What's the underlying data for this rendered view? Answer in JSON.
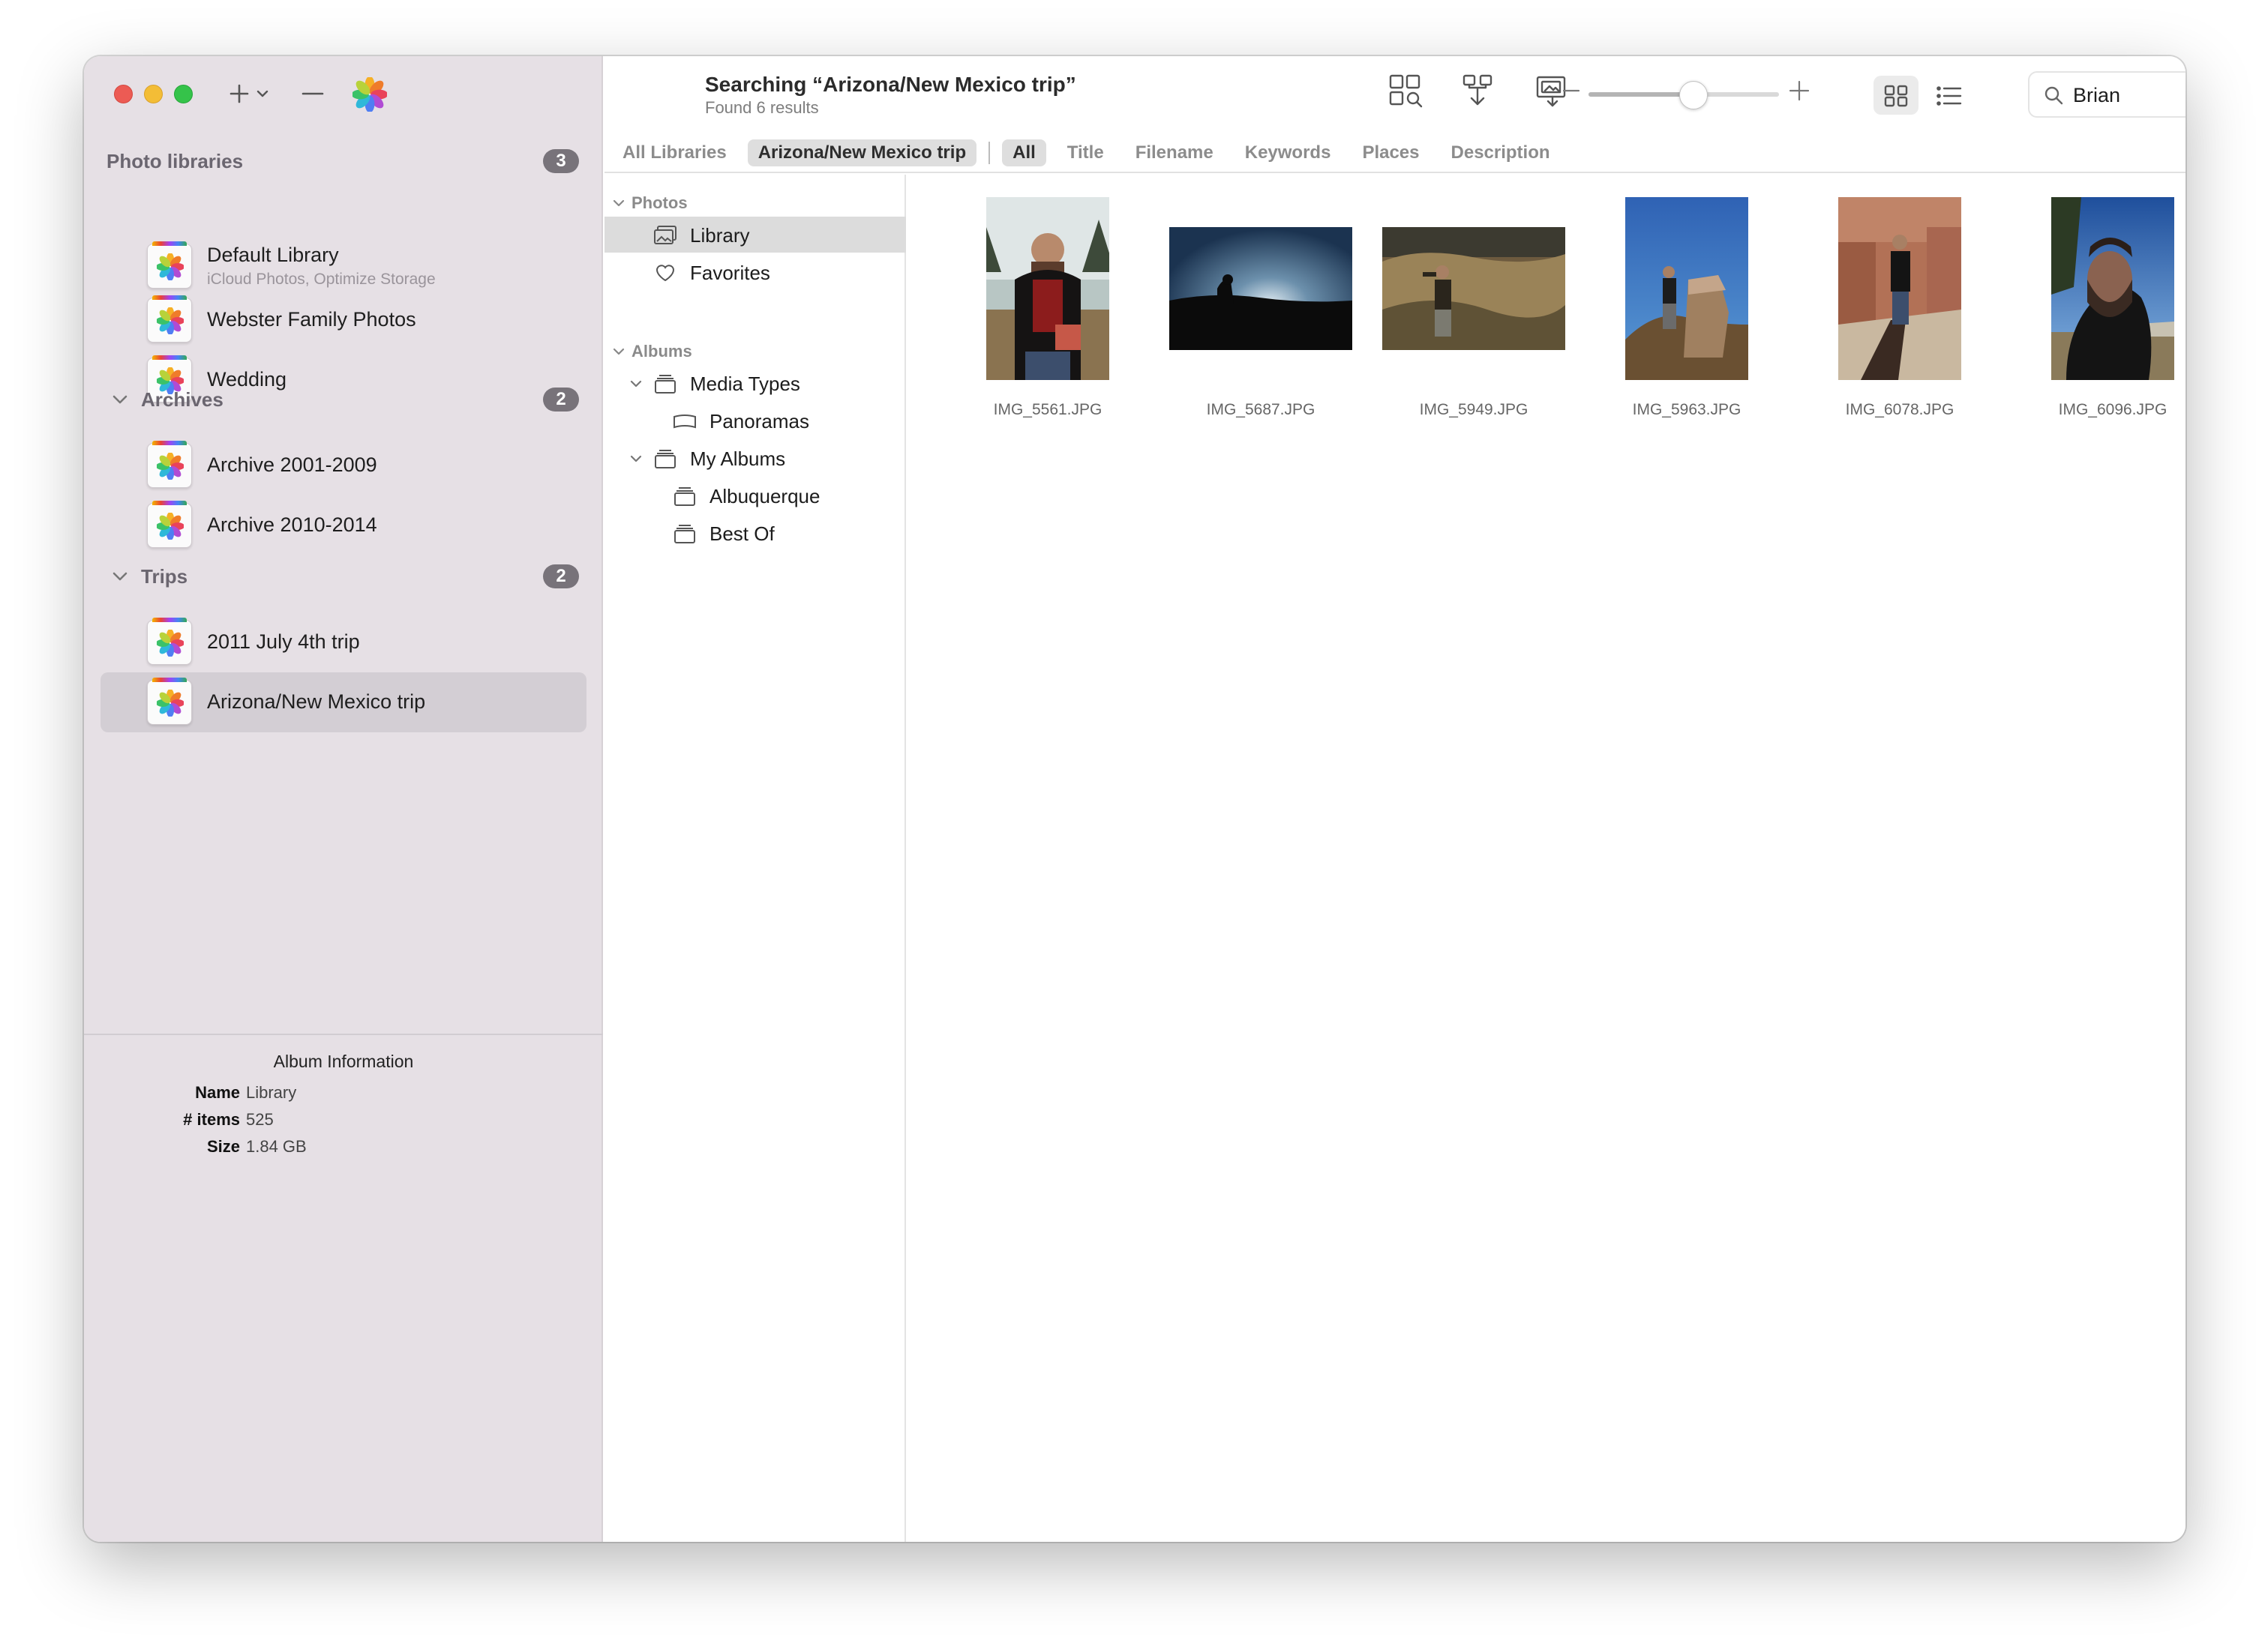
{
  "toolbar": {
    "title": "Searching “Arizona/New Mexico trip”",
    "subtitle": "Found 6 results",
    "search_value": "Brian"
  },
  "sidebar": {
    "sections": [
      {
        "title": "Photo libraries",
        "count": "3"
      },
      {
        "title": "Archives",
        "count": "2"
      },
      {
        "title": "Trips",
        "count": "2"
      }
    ],
    "items": [
      {
        "label": "Default Library",
        "sublabel": "iCloud Photos, Optimize Storage"
      },
      {
        "label": "Webster Family Photos"
      },
      {
        "label": "Wedding"
      },
      {
        "label": "Archive 2001-2009"
      },
      {
        "label": "Archive 2010-2014"
      },
      {
        "label": "2011 July 4th trip"
      },
      {
        "label": "Arizona/New Mexico trip"
      }
    ]
  },
  "info": {
    "title": "Album Information",
    "rows": [
      {
        "key": "Name",
        "value": "Library"
      },
      {
        "key": "# items",
        "value": "525"
      },
      {
        "key": "Size",
        "value": "1.84 GB"
      }
    ]
  },
  "scope": {
    "all_libraries": "All Libraries",
    "current": "Arizona/New Mexico trip",
    "fields": [
      "All",
      "Title",
      "Filename",
      "Keywords",
      "Places",
      "Description"
    ]
  },
  "source": {
    "photos_group": "Photos",
    "library": "Library",
    "favorites": "Favorites",
    "albums_group": "Albums",
    "media_types": "Media Types",
    "panoramas": "Panoramas",
    "my_albums": "My Albums",
    "albuquerque": "Albuquerque",
    "best_of": "Best Of"
  },
  "zoom": {
    "level": 0.55
  },
  "photos": [
    {
      "name": "IMG_5561.JPG"
    },
    {
      "name": "IMG_5687.JPG"
    },
    {
      "name": "IMG_5949.JPG"
    },
    {
      "name": "IMG_5963.JPG"
    },
    {
      "name": "IMG_6078.JPG"
    },
    {
      "name": "IMG_6096.JPG"
    }
  ]
}
